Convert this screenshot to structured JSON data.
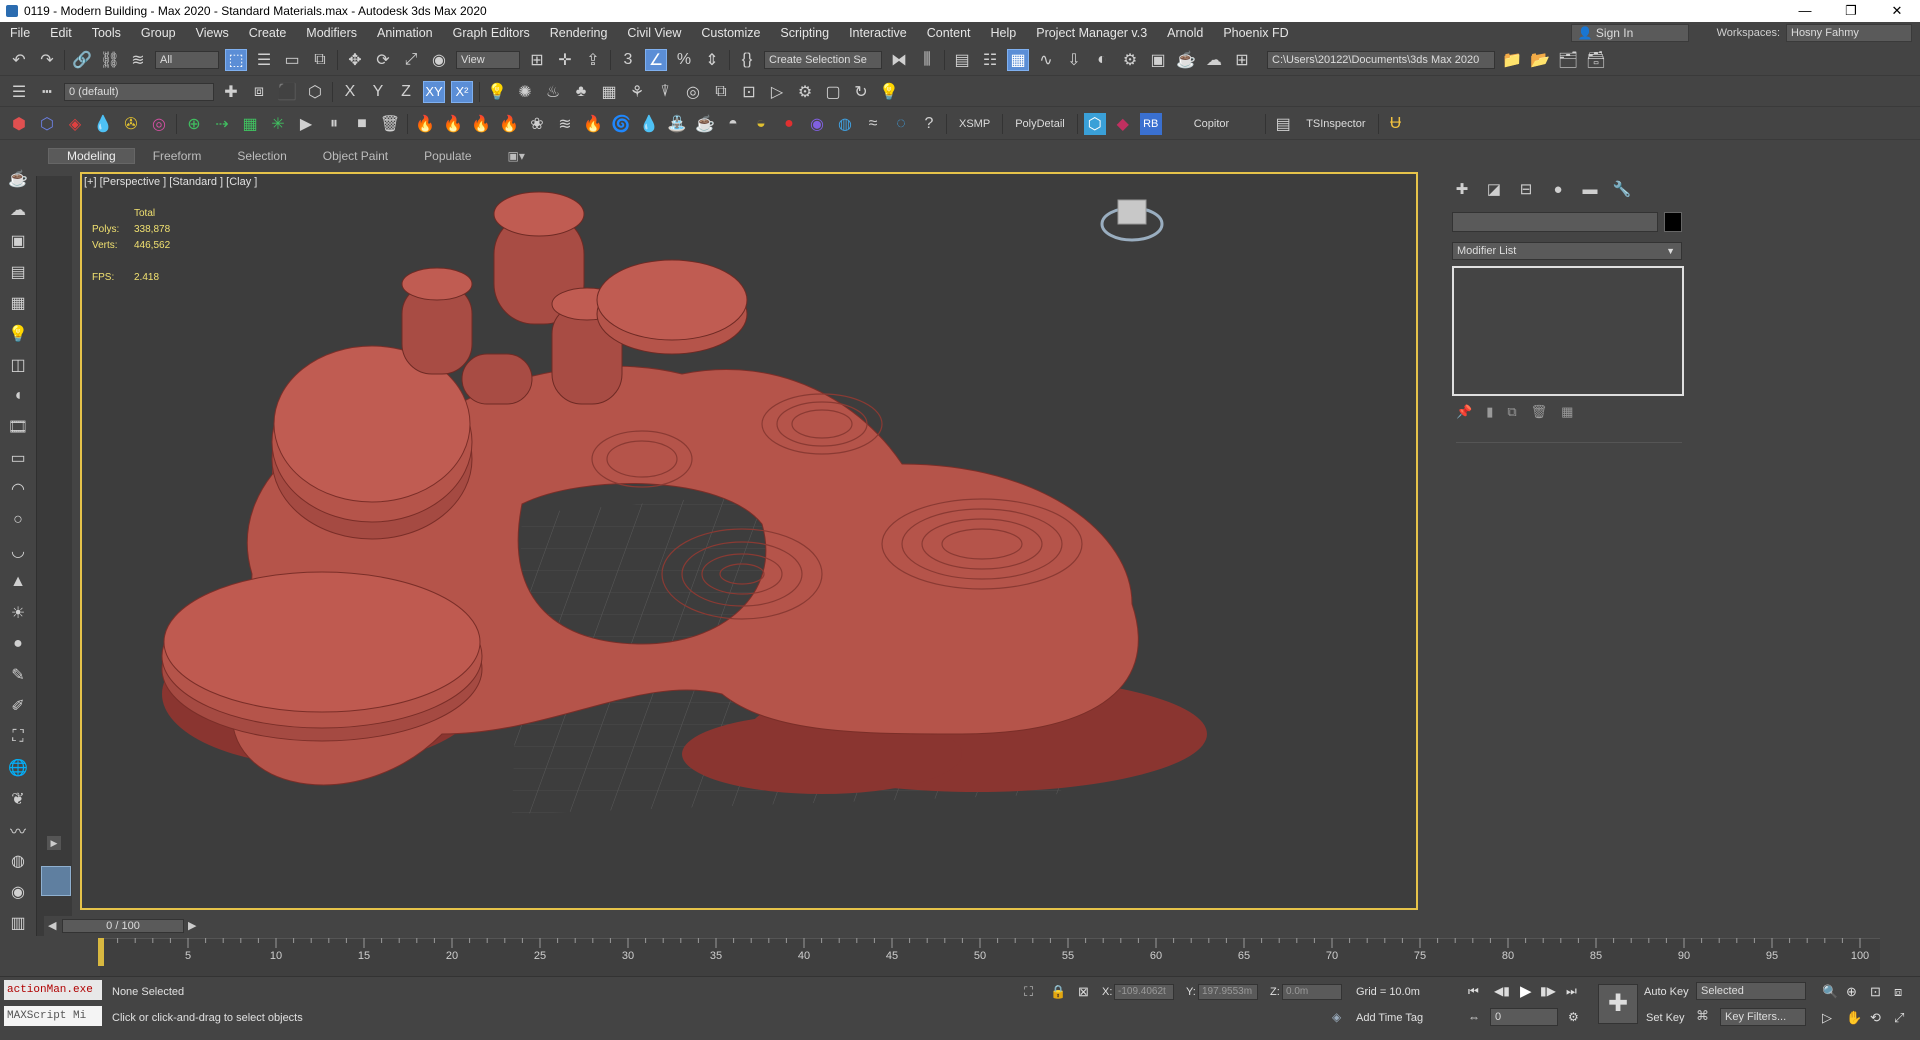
{
  "window": {
    "title": "0119 - Modern Building - Max 2020 - Standard Materials.max - Autodesk 3ds Max 2020",
    "minimize": "—",
    "restore": "❐",
    "close": "✕"
  },
  "menu": {
    "items": [
      "File",
      "Edit",
      "Tools",
      "Group",
      "Views",
      "Create",
      "Modifiers",
      "Animation",
      "Graph Editors",
      "Rendering",
      "Civil View",
      "Customize",
      "Scripting",
      "Interactive",
      "Content",
      "Help",
      "Project Manager v.3",
      "Arnold",
      "Phoenix FD"
    ],
    "sign_in": "Sign In",
    "workspaces_label": "Workspaces:",
    "workspace_value": "Hosny Fahmy"
  },
  "toolbar1": {
    "filter_value": "All",
    "view_value": "View",
    "selection_set": "Create Selection Se",
    "project_path": "C:\\Users\\20122\\Documents\\3ds Max 2020"
  },
  "toolbar2": {
    "layer_value": "0 (default)",
    "axis_x": "X",
    "axis_y": "Y",
    "axis_z": "Z",
    "axis_xy": "XY"
  },
  "toolbar3": {
    "xsmp": "XSMP",
    "polydetail": "PolyDetail",
    "rb": "RB",
    "copitor": "Copitor",
    "tsinspector": "TSInspector"
  },
  "ribbon": {
    "tabs": [
      "Modeling",
      "Freeform",
      "Selection",
      "Object Paint",
      "Populate"
    ],
    "active": "Modeling"
  },
  "viewport": {
    "label": "[+] [Perspective ] [Standard ] [Clay ]",
    "stats": {
      "total_label": "Total",
      "polys_label": "Polys:",
      "polys_value": "338,878",
      "verts_label": "Verts:",
      "verts_value": "446,562",
      "fps_label": "FPS:",
      "fps_value": "2.418"
    },
    "model_color": "#b5544a"
  },
  "command_panel": {
    "modifier_list": "Modifier List"
  },
  "timeline": {
    "slider_value": "0 / 100",
    "ticks": [
      0,
      5,
      10,
      15,
      20,
      25,
      30,
      35,
      40,
      45,
      50,
      55,
      60,
      65,
      70,
      75,
      80,
      85,
      90,
      95,
      100
    ]
  },
  "status": {
    "maxscript_line1": "actionMan.exe",
    "maxscript_line2": "MAXScript Mi",
    "selection_text": "None Selected",
    "prompt_text": "Click or click-and-drag to select objects",
    "x_label": "X:",
    "x_value": "-109.4062t",
    "y_label": "Y:",
    "y_value": "197.9553m",
    "z_label": "Z:",
    "z_value": "0.0m",
    "grid": "Grid = 10.0m",
    "add_time_tag": "Add Time Tag",
    "auto_key": "Auto Key",
    "selected_drop": "Selected",
    "set_key": "Set Key",
    "key_filters": "Key Filters...",
    "frame_value": "0"
  }
}
